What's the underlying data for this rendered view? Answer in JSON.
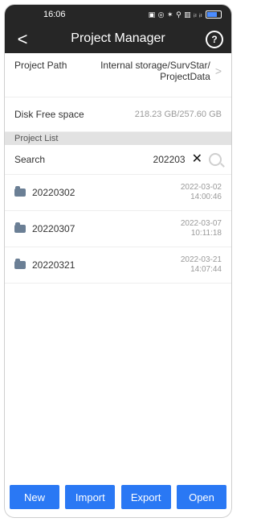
{
  "statusbar": {
    "time": "16:06",
    "icons_text": "▣ ◎ ✶ ⚲ ▥ ᵢₗ ᵢₗ"
  },
  "topbar": {
    "title": "Project Manager",
    "back_glyph": "<",
    "help_glyph": "?"
  },
  "project_path": {
    "label": "Project Path",
    "value_line1": "Internal storage/SurvStar/",
    "value_line2": "ProjectData",
    "chevron": ">"
  },
  "disk_free": {
    "label": "Disk Free space",
    "value": "218.23 GB/257.60 GB"
  },
  "section": {
    "title": "Project List"
  },
  "search": {
    "label": "Search",
    "value": "202203",
    "clear_glyph": "✕"
  },
  "projects": [
    {
      "name": "20220302",
      "date": "2022-03-02",
      "time": "14:00:46"
    },
    {
      "name": "20220307",
      "date": "2022-03-07",
      "time": "10:11:18"
    },
    {
      "name": "20220321",
      "date": "2022-03-21",
      "time": "14:07:44"
    }
  ],
  "bottom_buttons": {
    "new": "New",
    "import": "Import",
    "export": "Export",
    "open": "Open"
  },
  "colors": {
    "header_bg": "#262626",
    "accent": "#2a78f4",
    "section_bg": "#e2e2e2"
  },
  "icons": {
    "back": "back-icon",
    "help": "help-icon",
    "folder": "folder-icon",
    "clear": "clear-icon",
    "search": "search-icon"
  }
}
